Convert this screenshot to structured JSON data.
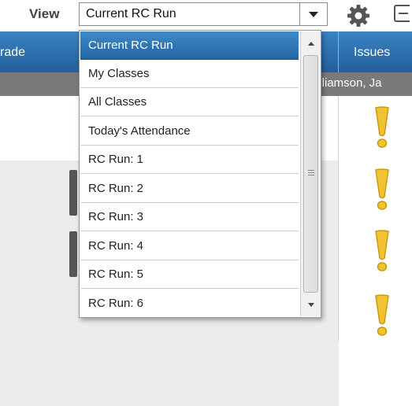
{
  "toolbar": {
    "view_label": "View",
    "view_value": "Current RC Run",
    "icons": [
      "chevron-down-icon",
      "gear-icon",
      "collapse-icon"
    ]
  },
  "table": {
    "columns": [
      "rade",
      "Issues"
    ],
    "subheader_name": "illiamson, Ja",
    "issue_icon": "warning-exclamation-icon",
    "colors": {
      "header": "#2f72b1",
      "issue_yellow": "#f1c232"
    }
  },
  "dropdown": {
    "options": [
      "Current RC Run",
      "My Classes",
      "All Classes",
      "Today's Attendance",
      "RC Run: 1",
      "RC Run: 2",
      "RC Run: 3",
      "RC Run: 4",
      "RC Run: 5",
      "RC Run: 6"
    ],
    "selected": "Current RC Run"
  }
}
